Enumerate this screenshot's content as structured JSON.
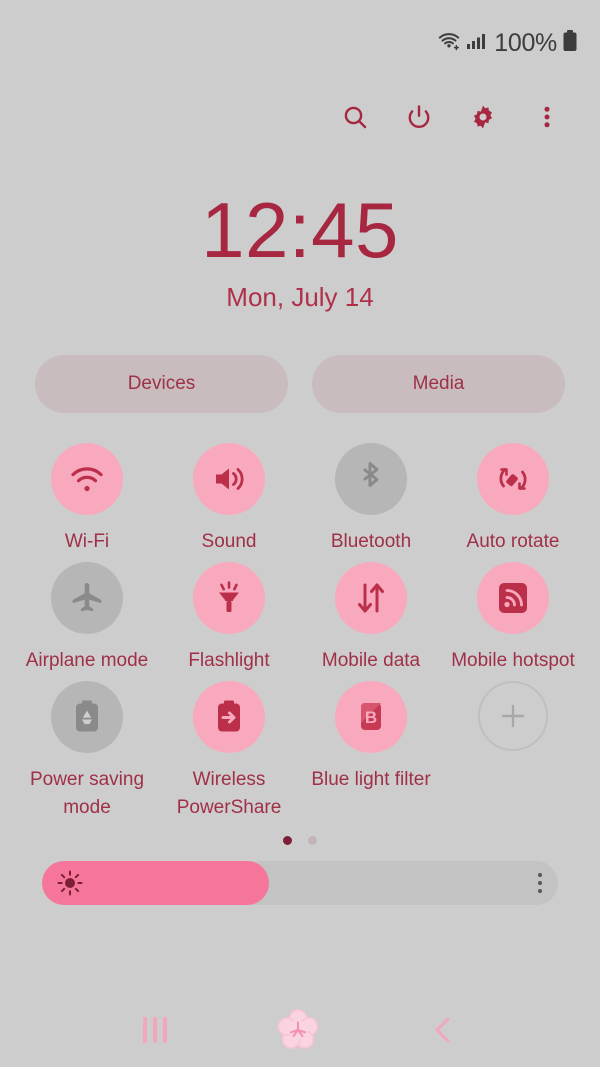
{
  "status_bar": {
    "wifi_icon": "wifi-icon",
    "signal_icon": "cellular-signal-icon",
    "battery_percent": "100%",
    "battery_icon": "battery-full-icon"
  },
  "toolbar": {
    "search_icon": "search-icon",
    "power_icon": "power-icon",
    "settings_icon": "gear-icon",
    "more_icon": "more-vertical-icon"
  },
  "clock": {
    "time": "12:45",
    "date": "Mon, July 14"
  },
  "shortcuts": [
    {
      "label": "Devices",
      "name": "devices-button"
    },
    {
      "label": "Media",
      "name": "media-button"
    }
  ],
  "toggles": [
    {
      "label": "Wi-Fi",
      "icon": "wifi-icon",
      "active": true
    },
    {
      "label": "Sound",
      "icon": "sound-icon",
      "active": true
    },
    {
      "label": "Bluetooth",
      "icon": "bluetooth-icon",
      "active": false
    },
    {
      "label": "Auto rotate",
      "icon": "auto-rotate-icon",
      "active": true
    },
    {
      "label": "Airplane mode",
      "icon": "airplane-icon",
      "active": false
    },
    {
      "label": "Flashlight",
      "icon": "flashlight-icon",
      "active": true
    },
    {
      "label": "Mobile data",
      "icon": "mobile-data-icon",
      "active": true
    },
    {
      "label": "Mobile hotspot",
      "icon": "hotspot-icon",
      "active": true
    },
    {
      "label": "Power saving mode",
      "icon": "power-saving-icon",
      "active": false
    },
    {
      "label": "Wireless PowerShare",
      "icon": "wireless-powershare-icon",
      "active": true
    },
    {
      "label": "Blue light filter",
      "icon": "blue-light-filter-icon",
      "active": true
    },
    {
      "label": "",
      "icon": "add-icon",
      "active": false
    }
  ],
  "pagination": {
    "pages": 2,
    "current": 1
  },
  "brightness": {
    "value_percent": 44,
    "sun_icon": "brightness-sun-icon",
    "menu_icon": "more-vertical-icon"
  },
  "nav_bar": {
    "recents_icon": "recents-icon",
    "home_icon": "home-blossom-icon",
    "back_icon": "back-chevron-icon"
  },
  "colors": {
    "background": "#cdcdcd",
    "accent_crimson": "#a72741",
    "accent_pink": "#f9a9bd",
    "slider_pink": "#f5759b",
    "inactive_gray": "#b6b6b6"
  }
}
